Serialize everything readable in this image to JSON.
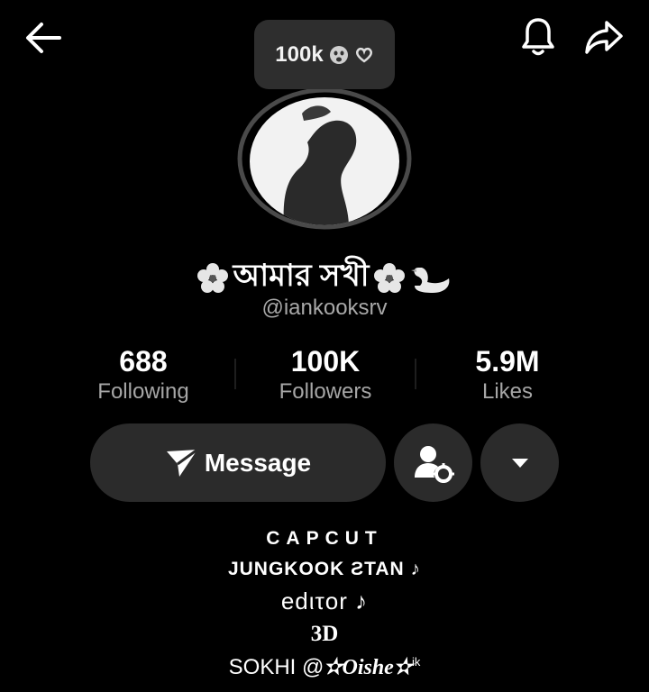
{
  "header": {
    "back_icon": "arrow-left-icon",
    "bell_icon": "bell-icon",
    "share_icon": "share-arrow-icon"
  },
  "badge": {
    "text": "100k",
    "emojis": [
      "crying-face-icon",
      "heart-hands-icon"
    ]
  },
  "profile": {
    "display_name": "আমার সখী",
    "name_decorations": [
      "cherry-blossom-icon",
      "cherry-blossom-icon",
      "swan-icon"
    ],
    "handle": "@iankooksrv"
  },
  "stats": {
    "following": {
      "value": "688",
      "label": "Following"
    },
    "followers": {
      "value": "100K",
      "label": "Followers"
    },
    "likes": {
      "value": "5.9M",
      "label": "Likes"
    }
  },
  "actions": {
    "message_label": "Message"
  },
  "bio": {
    "line1": "CAPCUT",
    "line2": "JUNGKOOK ƧTAN ♪",
    "line3": "edιτor ♪",
    "line4": "3D",
    "line5_prefix": "SOKHI @",
    "line5_name": "✫Oishe✫",
    "line5_sup": "ik"
  },
  "colors": {
    "background": "#000000",
    "button": "#2b2b2b",
    "secondary_text": "#a6a6a6"
  }
}
